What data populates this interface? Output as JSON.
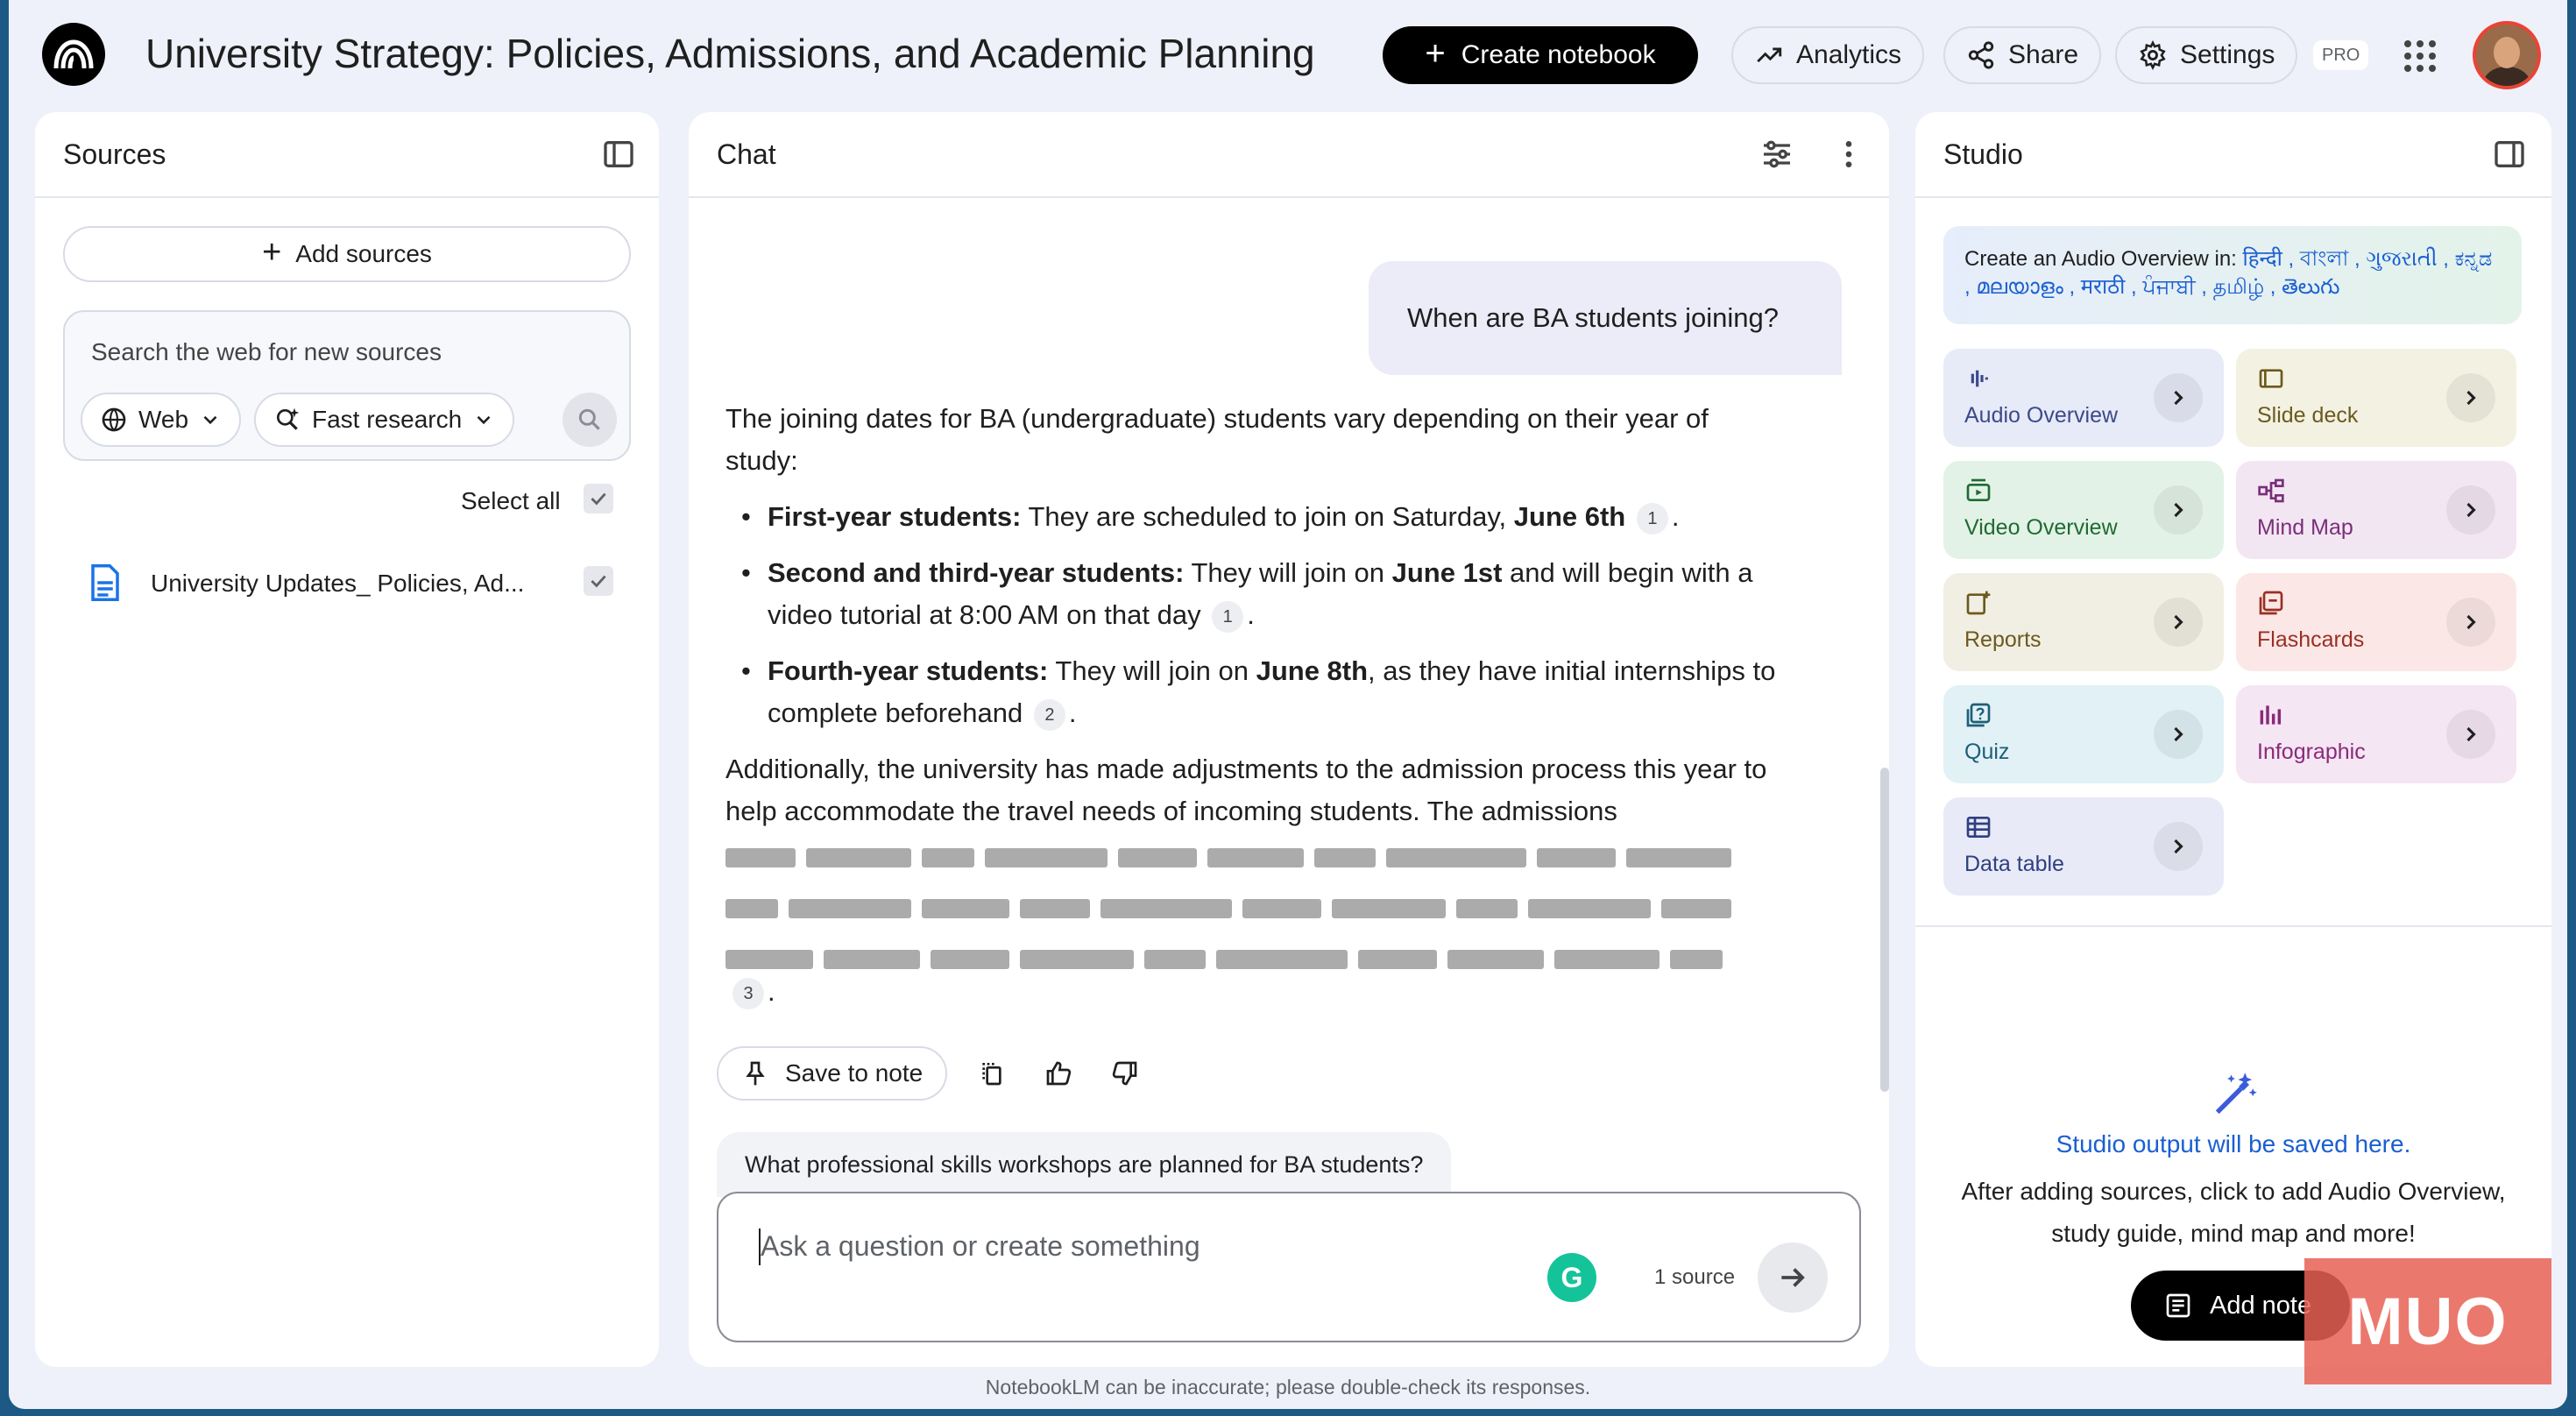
{
  "header": {
    "notebook_title": "University Strategy: Policies, Admissions, and Academic Planning",
    "create_notebook": "Create notebook",
    "analytics": "Analytics",
    "share": "Share",
    "settings": "Settings",
    "pro_badge": "PRO"
  },
  "sources": {
    "title": "Sources",
    "add_sources": "Add sources",
    "search_placeholder": "Search the web for new sources",
    "web_pill": "Web",
    "research_pill": "Fast research",
    "select_all": "Select all",
    "items": [
      {
        "name": "University Updates_ Policies, Ad...",
        "checked": true
      }
    ]
  },
  "chat": {
    "title": "Chat",
    "user_question": "When are BA students joining?",
    "answer": {
      "intro": "The joining dates for BA (undergraduate) students vary depending on their year of study:",
      "bullets": [
        {
          "lead": "First-year students:",
          "text1": " They are scheduled to join on Saturday, ",
          "bold": "June 6th",
          "text2": "",
          "cite": "1"
        },
        {
          "lead": "Second and third-year students:",
          "text1": " They will join on ",
          "bold": "June 1st",
          "text2": " and will begin with a video tutorial at 8:00 AM on that day",
          "cite": "1"
        },
        {
          "lead": "Fourth-year students:",
          "text1": " They will join on ",
          "bold": "June 8th",
          "text2": ", as they have initial internships to complete beforehand",
          "cite": "2"
        }
      ],
      "additional": "Additionally, the university has made adjustments to the admission process this year to help accommodate the travel needs of incoming students. The admissions",
      "final_cite": "3"
    },
    "save_to_note": "Save to note",
    "suggestion": "What professional skills workshops are planned for BA students?",
    "input_placeholder": "Ask a question or create something",
    "source_count": "1 source"
  },
  "studio": {
    "title": "Studio",
    "audio_prefix": "Create an Audio Overview in: ",
    "audio_langs": "हिन्दी , বাংলা , ગુજરાતી , ಕನ್ನಡ , മലയാളം , मराठी , ਪੰਜਾਬੀ , தமிழ் , తెలుగు",
    "tiles": [
      {
        "label": "Audio Overview",
        "icon": "waveform-icon",
        "color": "#e7eaf7",
        "text": "#3b4a8a"
      },
      {
        "label": "Slide deck",
        "icon": "slides-icon",
        "color": "#f3f1e2",
        "text": "#6b5a1e"
      },
      {
        "label": "Video Overview",
        "icon": "video-icon",
        "color": "#e3f2e6",
        "text": "#1f6b33"
      },
      {
        "label": "Mind Map",
        "icon": "mindmap-icon",
        "color": "#f3e6f3",
        "text": "#7a2f7a"
      },
      {
        "label": "Reports",
        "icon": "reports-icon",
        "color": "#f1efe3",
        "text": "#6b5a1e"
      },
      {
        "label": "Flashcards",
        "icon": "flashcards-icon",
        "color": "#fbe8e6",
        "text": "#9a2f24"
      },
      {
        "label": "Quiz",
        "icon": "quiz-icon",
        "color": "#e1f1f6",
        "text": "#1d5f78"
      },
      {
        "label": "Infographic",
        "icon": "infographic-icon",
        "color": "#f5e6f3",
        "text": "#8a2a7a"
      },
      {
        "label": "Data table",
        "icon": "table-icon",
        "color": "#e8eaf7",
        "text": "#2f3f80"
      }
    ],
    "output_title": "Studio output will be saved here.",
    "output_help": "After adding sources, click to add Audio Overview, study guide, mind map and more!",
    "add_note": "Add note"
  },
  "watermark": "MUO",
  "footer": "NotebookLM can be inaccurate; please double-check its responses."
}
